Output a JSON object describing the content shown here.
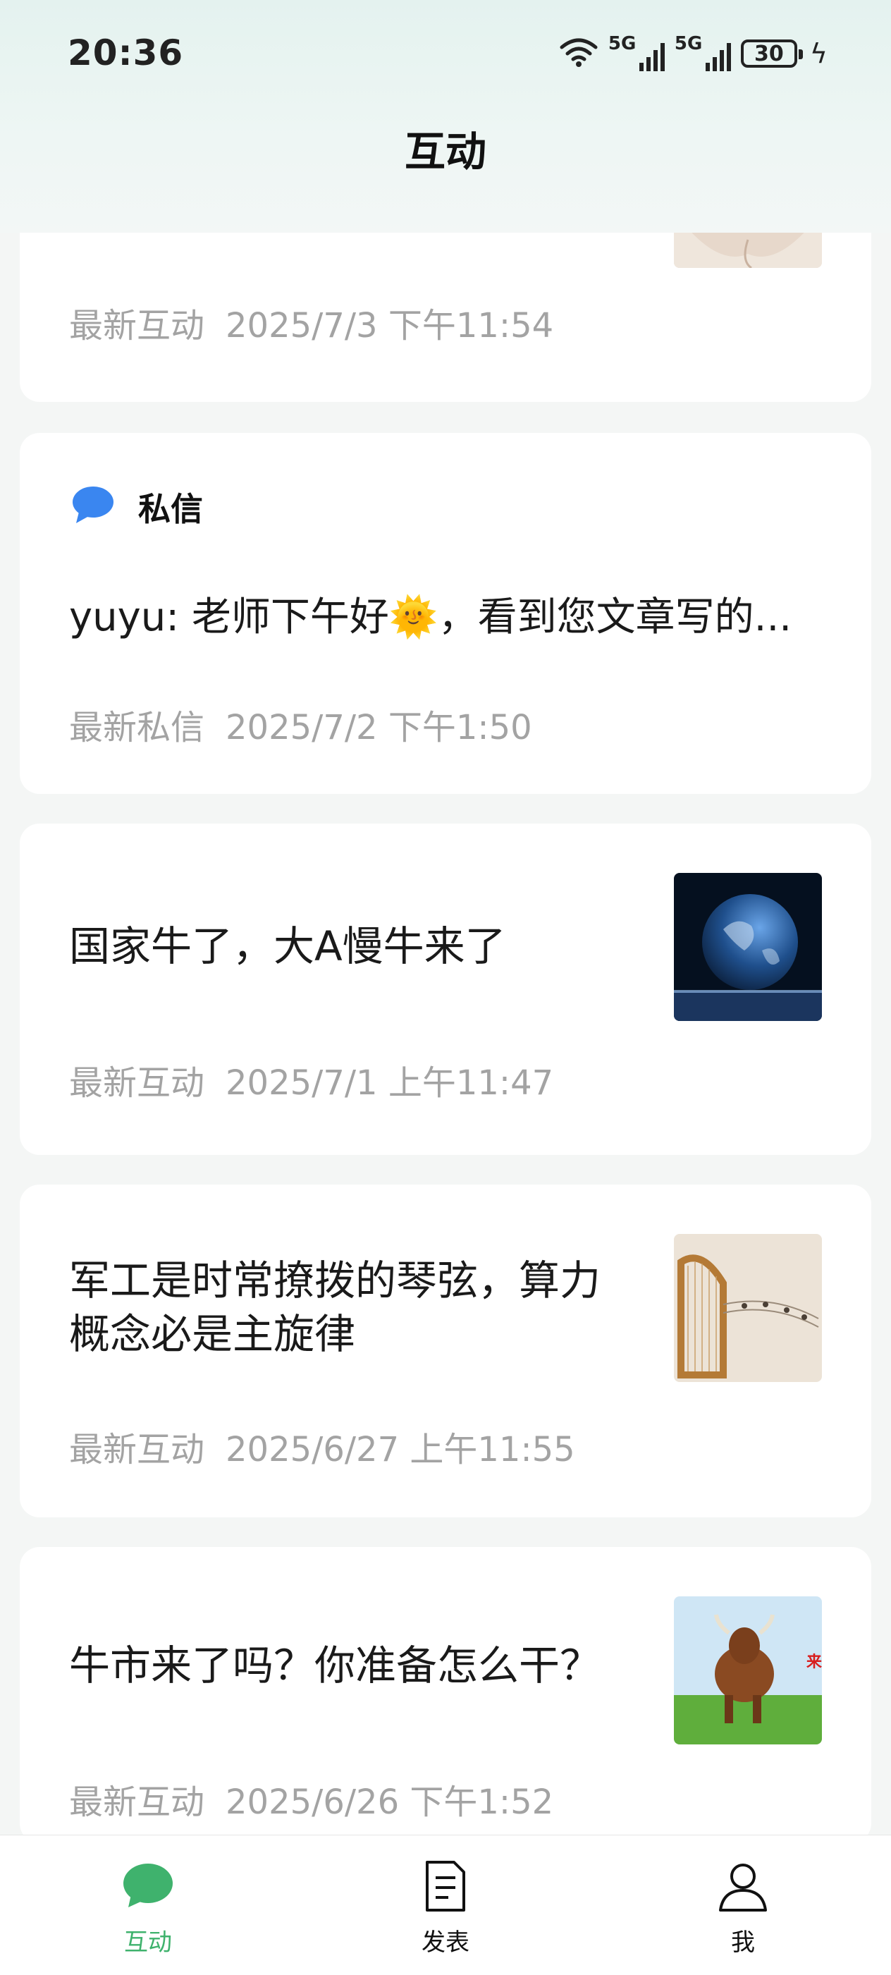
{
  "status_bar": {
    "time": "20:36",
    "signal1": "5G",
    "signal2": "5G",
    "battery": "30",
    "icons": [
      "wifi-icon",
      "signal-icon",
      "signal-icon",
      "battery-icon",
      "charging-icon"
    ]
  },
  "header": {
    "title": "互动"
  },
  "cards": [
    {
      "title": "",
      "meta_label": "最新互动",
      "meta_time": "2025/7/3 下午11:54",
      "thumbnail": "photo-thumbnail"
    },
    {
      "badge": "私信",
      "badge_icon": "chat-bubble-icon",
      "message": "yuyu: 老师下午好🌞，看到您文章写的...",
      "meta_label": "最新私信",
      "meta_time": "2025/7/2 下午1:50"
    },
    {
      "title": "国家牛了，大A慢牛来了",
      "meta_label": "最新互动",
      "meta_time": "2025/7/1 上午11:47",
      "thumbnail": "earth-thumbnail"
    },
    {
      "title_line1": "军工是时常撩拨的琴弦，算力",
      "title_line2": "概念必是主旋律",
      "meta_label": "最新互动",
      "meta_time": "2025/6/27 上午11:55",
      "thumbnail": "harp-thumbnail"
    },
    {
      "title": "牛市来了吗？你准备怎么干？",
      "meta_label": "最新互动",
      "meta_time": "2025/6/26 下午1:52",
      "thumbnail": "bull-thumbnail",
      "thumbnail_text": "来"
    }
  ],
  "colors": {
    "accent": "#3fb26d",
    "badge_blue": "#3a86f0",
    "meta_gray": "#a3a3a3"
  },
  "bottom_nav": [
    {
      "label": "互动",
      "icon": "chat-bubble-icon",
      "active": true
    },
    {
      "label": "发表",
      "icon": "document-icon",
      "active": false
    },
    {
      "label": "我",
      "icon": "person-icon",
      "active": false
    }
  ]
}
